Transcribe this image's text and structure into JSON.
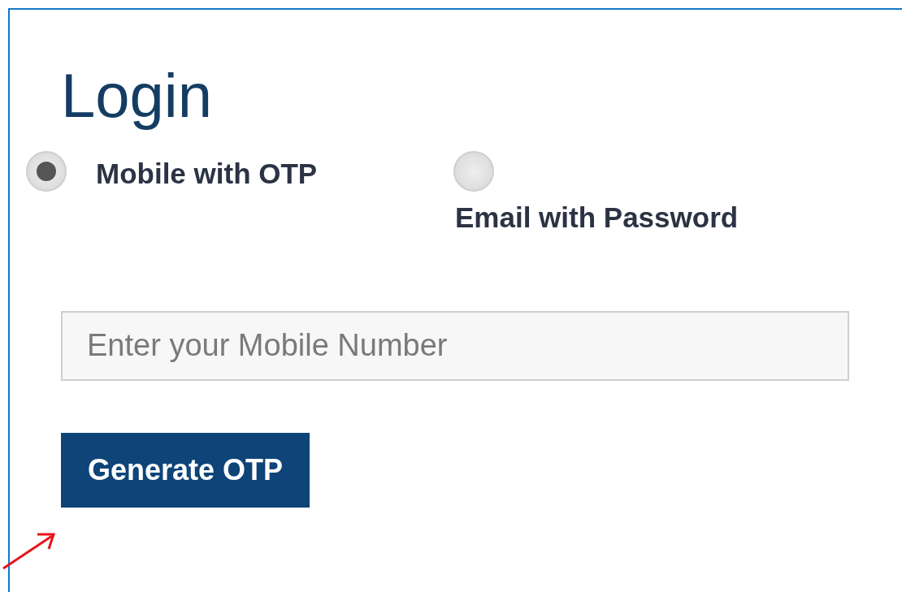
{
  "title": "Login",
  "login_options": [
    {
      "label": "Mobile with OTP",
      "selected": true
    },
    {
      "label": "Email with Password",
      "selected": false
    }
  ],
  "mobile_field": {
    "placeholder": "Enter your Mobile Number"
  },
  "buttons": [
    "Generate OTP"
  ]
}
